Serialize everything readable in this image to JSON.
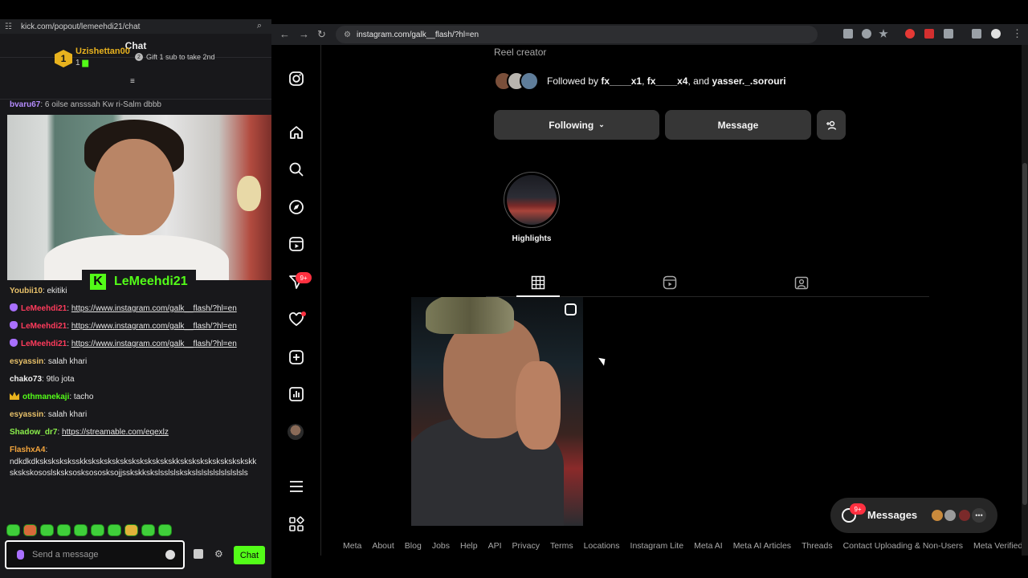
{
  "kick": {
    "url": "kick.com/popout/lemeehdi21/chat",
    "title": "Chat",
    "top_gifter": {
      "rank": "1",
      "name": "Uzishettan00",
      "count": "1"
    },
    "gift_promo": "Gift 1 sub to take 2nd",
    "cut_message": {
      "user": "bvaru67",
      "text": ": 6 oilse ansssah Kw ri-Salm dbbb"
    },
    "streamer": "LeMeehdi21",
    "messages": [
      {
        "user": "Youbii10",
        "sep": ": ",
        "text": "ekitiki",
        "color": "#e8c16a",
        "badge": ""
      },
      {
        "user": "LeMeehdi21",
        "sep": ": ",
        "text": "https://www.instagram.com/galk__flash/?hl=en",
        "color": "#ff3b5c",
        "badge": "mic",
        "link": true
      },
      {
        "user": "LeMeehdi21",
        "sep": ": ",
        "text": "https://www.instagram.com/galk__flash/?hl=en",
        "color": "#ff3b5c",
        "badge": "mic",
        "link": true
      },
      {
        "user": "LeMeehdi21",
        "sep": ": ",
        "text": "https://www.instagram.com/galk__flash/?hl=en",
        "color": "#ff3b5c",
        "badge": "mic",
        "link": true
      },
      {
        "user": "esyassin",
        "sep": ": ",
        "text": "salah khari",
        "color": "#e8c16a",
        "badge": ""
      },
      {
        "user": "chako73",
        "sep": ": ",
        "text": "9tlo jota",
        "color": "#f0f0f0",
        "badge": ""
      },
      {
        "user": "othmanekaji",
        "sep": ": ",
        "text": "tacho",
        "color": "#53fc18",
        "badge": "crown"
      },
      {
        "user": "esyassin",
        "sep": ": ",
        "text": "salah khari",
        "color": "#e8c16a",
        "badge": ""
      },
      {
        "user": "Shadow_dr7",
        "sep": ": ",
        "text": "https://streamable.com/eqexlz",
        "color": "#8bf04b",
        "badge": "",
        "link": true
      },
      {
        "user": "FlashxA4",
        "sep": ":",
        "text": "ndkdkdksksksksksskkskskskskskskskskskskskkskskskskskskskskskkskskskososlsksksosksososksojjsskskkskslsslslskskslslslslslslslslsls",
        "color": "#f4a53c",
        "badge": ""
      }
    ],
    "input_placeholder": "Send a message",
    "chat_button": "Chat"
  },
  "browser": {
    "url": "instagram.com/galk__flash/?hl=en"
  },
  "instagram": {
    "category": "Reel creator",
    "followed_by": {
      "prefix": "Followed by ",
      "u1": "fx____x1",
      "sep1": ", ",
      "u2": "fx____x4",
      "sep2": ", and ",
      "u3": "yasser._.sorouri"
    },
    "following_button": "Following",
    "message_button": "Message",
    "highlight_label": "Highlights",
    "notifications_badge": "9+",
    "messages_label": "Messages",
    "messages_badge": "9+",
    "footer_links": [
      "Meta",
      "About",
      "Blog",
      "Jobs",
      "Help",
      "API",
      "Privacy",
      "Terms",
      "Locations",
      "Instagram Lite",
      "Meta AI",
      "Meta AI Articles",
      "Threads",
      "Contact Uploading & Non-Users",
      "Meta Verified"
    ]
  },
  "icons": {
    "sidebar": [
      "instagram-logo-icon",
      "home-icon",
      "search-icon",
      "explore-icon",
      "reels-icon",
      "messages-icon",
      "notifications-heart-icon",
      "create-icon",
      "dashboard-icon",
      "profile-avatar",
      "more-menu-icon",
      "also-from-meta-icon"
    ]
  }
}
